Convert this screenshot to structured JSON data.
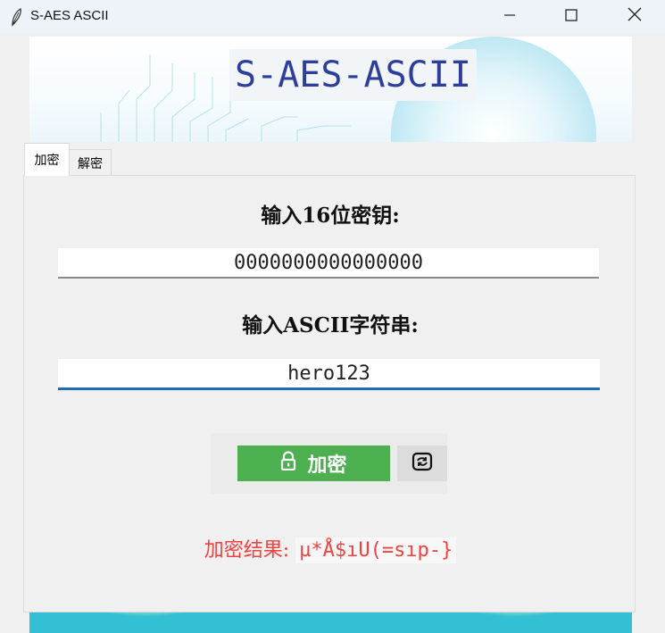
{
  "window": {
    "title": "S-AES ASCII"
  },
  "banner": {
    "heading": "S-AES-ASCII"
  },
  "tabs": [
    {
      "label": "加密",
      "active": true
    },
    {
      "label": "解密",
      "active": false
    }
  ],
  "encrypt": {
    "key_label": "输入16位密钥:",
    "key_value": "0000000000000000",
    "ascii_label": "输入ASCII字符串:",
    "ascii_value": "hero123",
    "encrypt_button_label": "加密",
    "result_prefix": "加密结果: ",
    "result_value": "µ*Å$ıU(=sıp-}"
  },
  "icons": {
    "app": "feather-icon",
    "minimize": "minimize-icon",
    "maximize": "maximize-icon",
    "close": "close-icon",
    "lock": "lock-icon",
    "reset": "refresh-icon"
  },
  "colors": {
    "accent": "#4caf50",
    "result_text": "#f14141",
    "heading": "#2d3f9b",
    "focus_underline": "#1f6db7"
  }
}
